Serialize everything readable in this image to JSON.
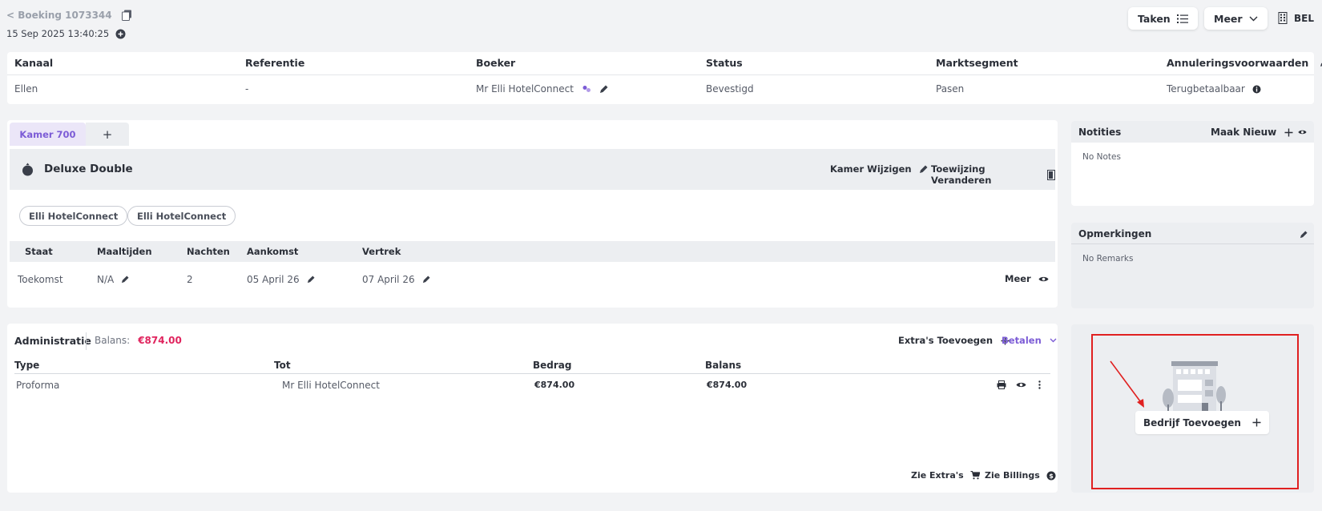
{
  "header": {
    "back_link": "< Boeking 1073344",
    "timestamp": "15 Sep 2025 13:40:25",
    "taken_label": "Taken",
    "meer_label": "Meer",
    "language": "BEL"
  },
  "booking_info": {
    "columns": [
      {
        "label": "Kanaal",
        "value": "Ellen"
      },
      {
        "label": "Referentie",
        "value": "-"
      },
      {
        "label": "Boeker",
        "value": "Mr Elli HotelConnect"
      },
      {
        "label": "Status",
        "value": "Bevestigd"
      },
      {
        "label": "Marktsegment",
        "value": "Pasen"
      },
      {
        "label": "Annuleringsvoorwaarden",
        "value": "Terugbetaalbaar"
      }
    ]
  },
  "room": {
    "tab_label": "Kamer 700",
    "add_tab": "+",
    "type": "Deluxe Double",
    "kamer_wijzigen": "Kamer Wijzigen",
    "toewijzing_veranderen": "Toewijzing Veranderen",
    "guests": [
      "Elli HotelConnect",
      "Elli HotelConnect"
    ],
    "columns": [
      "Staat",
      "Maaltijden",
      "Nachten",
      "Aankomst",
      "Vertrek"
    ],
    "row": {
      "staat": "Toekomst",
      "maaltijden": "N/A",
      "nachten": "2",
      "aankomst": "05 April 26",
      "vertrek": "07 April 26"
    },
    "meer_label": "Meer"
  },
  "admin": {
    "title": "Administratie",
    "balance_label": "Balans:",
    "balance_value": "€874.00",
    "extras_add": "Extra's Toevoegen",
    "betalen": "Betalen",
    "columns": [
      "Type",
      "Tot",
      "Bedrag",
      "Balans"
    ],
    "rows": [
      {
        "type": "Proforma",
        "tot": "Mr Elli HotelConnect",
        "bedrag": "€874.00",
        "balans": "€874.00"
      }
    ],
    "zie_extras": "Zie Extra's",
    "zie_billings": "Zie Billings"
  },
  "notes": {
    "title": "Notities",
    "maak_nieuw": "Maak Nieuw",
    "empty": "No Notes"
  },
  "remarks": {
    "title": "Opmerkingen",
    "empty": "No Remarks"
  },
  "company": {
    "add_label": "Bedrijf Toevoegen"
  },
  "colors": {
    "accent": "#7c5cd6",
    "balance": "#e0245e",
    "highlight_border": "#e02020"
  }
}
